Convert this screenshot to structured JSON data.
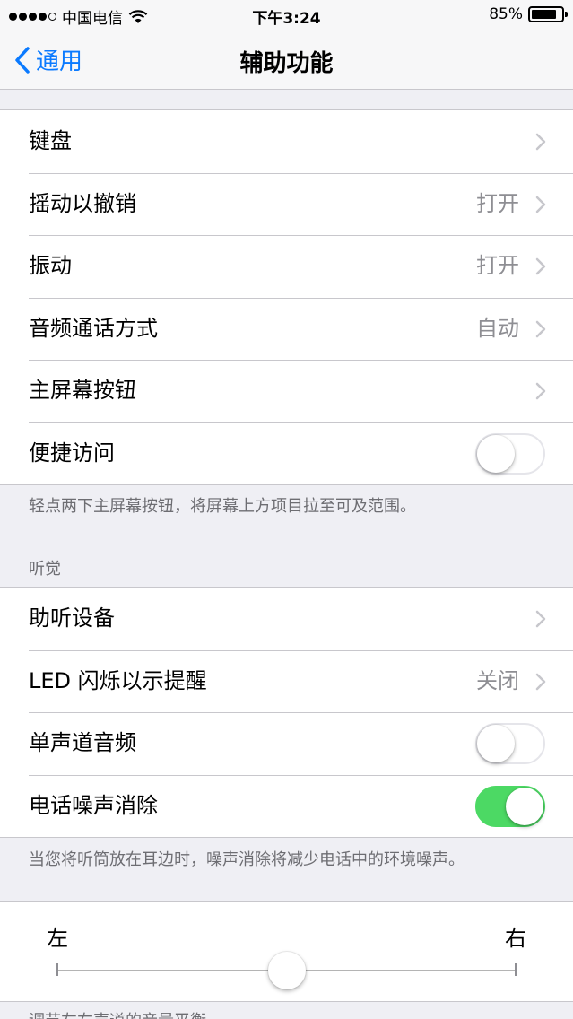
{
  "status_bar": {
    "carrier": "中国电信",
    "time": "下午3:24",
    "battery_text": "85%",
    "battery_level": 0.85
  },
  "nav": {
    "back_label": "通用",
    "title": "辅助功能"
  },
  "interaction_group": {
    "rows": [
      {
        "label": "键盘",
        "value": ""
      },
      {
        "label": "摇动以撤销",
        "value": "打开"
      },
      {
        "label": "振动",
        "value": "打开"
      },
      {
        "label": "音频通话方式",
        "value": "自动"
      },
      {
        "label": "主屏幕按钮",
        "value": ""
      },
      {
        "label": "便捷访问",
        "toggle": false
      }
    ],
    "footer": "轻点两下主屏幕按钮，将屏幕上方项目拉至可及范围。"
  },
  "hearing_group": {
    "header": "听觉",
    "rows": [
      {
        "label": "助听设备",
        "value": ""
      },
      {
        "label": "LED 闪烁以示提醒",
        "value": "关闭"
      },
      {
        "label": "单声道音频",
        "toggle": false
      },
      {
        "label": "电话噪声消除",
        "toggle": true
      }
    ],
    "footer": "当您将听筒放在耳边时，噪声消除将减少电话中的环境噪声。"
  },
  "balance": {
    "left_label": "左",
    "right_label": "右",
    "position": 0.5
  },
  "bottom_text": "调节左右声道的音量平衡。",
  "colors": {
    "accent": "#0a7aff",
    "toggle_on": "#4cd964"
  }
}
